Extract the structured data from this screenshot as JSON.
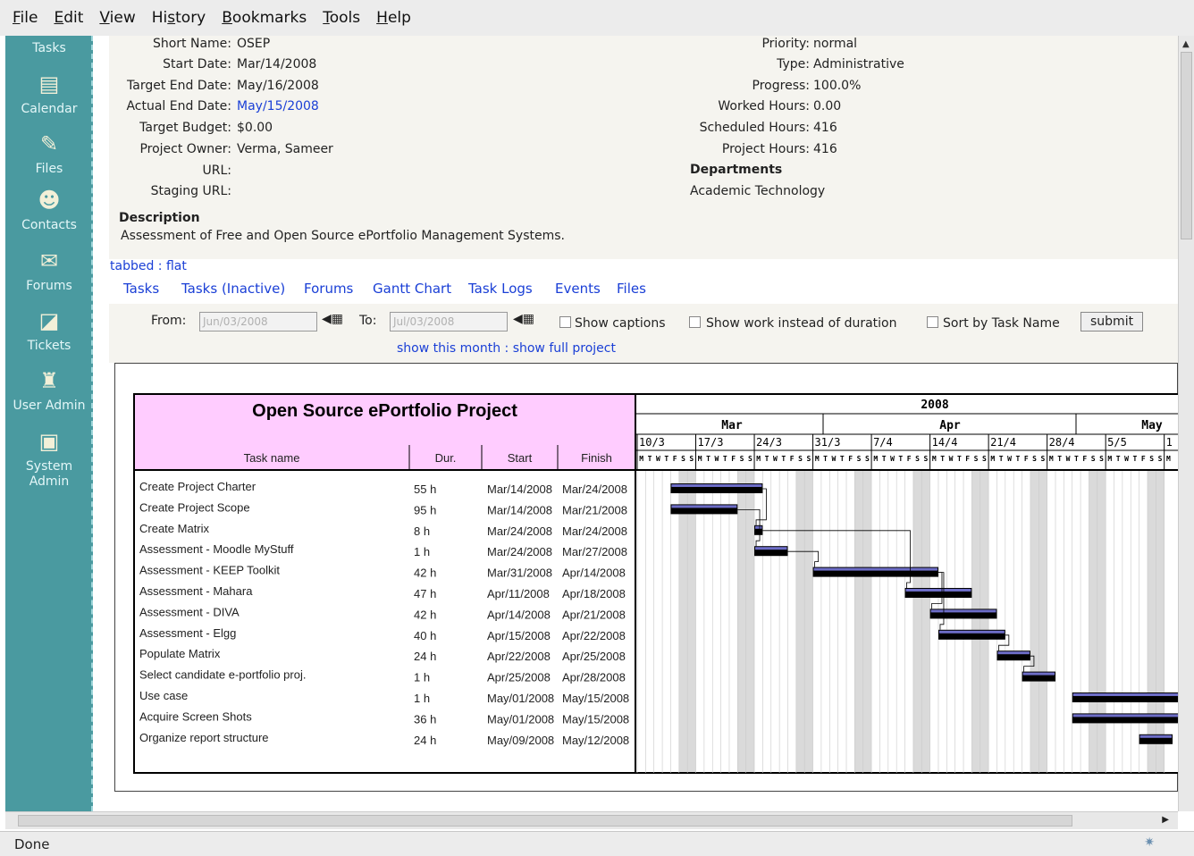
{
  "menu": [
    {
      "label": "File",
      "key": "F",
      "rest": "ile"
    },
    {
      "label": "Edit",
      "key": "E",
      "rest": "dit"
    },
    {
      "label": "View",
      "key": "V",
      "rest": "iew"
    },
    {
      "label": "History",
      "key": "H",
      "pre": "Hi",
      "u": "s",
      "post": "tory"
    },
    {
      "label": "Bookmarks",
      "key": "B",
      "rest": "ookmarks"
    },
    {
      "label": "Tools",
      "key": "T",
      "rest": "ools"
    },
    {
      "label": "Help",
      "key": "H",
      "rest": "elp"
    }
  ],
  "sidebar": {
    "items": [
      {
        "label": "Tasks",
        "icon": "tasks-icon"
      },
      {
        "label": "Calendar",
        "icon": "calendar-icon"
      },
      {
        "label": "Files",
        "icon": "files-icon"
      },
      {
        "label": "Contacts",
        "icon": "contacts-icon"
      },
      {
        "label": "Forums",
        "icon": "forums-icon"
      },
      {
        "label": "Tickets",
        "icon": "tickets-icon"
      },
      {
        "label": "User Admin",
        "icon": "user-admin-icon"
      },
      {
        "label": "System Admin",
        "icon": "system-admin-icon"
      }
    ]
  },
  "project": {
    "short_name_label": "Short Name:",
    "short_name": "OSEP",
    "start_date_label": "Start Date:",
    "start_date": "Mar/14/2008",
    "target_end_label": "Target End Date:",
    "target_end": "May/16/2008",
    "actual_end_label": "Actual End Date:",
    "actual_end": "May/15/2008",
    "budget_label": "Target Budget:",
    "budget": "$0.00",
    "owner_label": "Project Owner:",
    "owner": "Verma, Sameer",
    "url_label": "URL:",
    "staging_label": "Staging URL:",
    "priority_label": "Priority:",
    "priority": "normal",
    "type_label": "Type:",
    "type": "Administrative",
    "progress_label": "Progress:",
    "progress": "100.0%",
    "worked_label": "Worked Hours:",
    "worked": "0.00",
    "scheduled_label": "Scheduled Hours:",
    "scheduled": "416",
    "project_hours_label": "Project Hours:",
    "project_hours": "416",
    "departments_label": "Departments",
    "department": "Academic Technology",
    "description_label": "Description",
    "description": "Assessment of Free and Open Source ePortfolio Management Systems."
  },
  "view_modes": {
    "tabbed": "tabbed",
    "sep": ":",
    "flat": "flat"
  },
  "tabs": [
    "Tasks",
    "Tasks (Inactive)",
    "Forums",
    "Gantt Chart",
    "Task Logs",
    "Events",
    "Files"
  ],
  "filters": {
    "from_label": "From:",
    "from_value": "Jun/03/2008",
    "to_label": "To:",
    "to_value": "Jul/03/2008",
    "show_captions": "Show captions",
    "show_work": "Show work instead of duration",
    "sort_by_name": "Sort by Task Name",
    "submit": "submit",
    "show_month": "show this month",
    "sep": ":",
    "show_full": "show full project"
  },
  "chart_data": {
    "type": "gantt",
    "title": "Open Source ePortfolio Project",
    "columns": [
      "Task name",
      "Dur.",
      "Start",
      "Finish"
    ],
    "year": "2008",
    "months": [
      "Mar",
      "Apr",
      "May"
    ],
    "weeks": [
      "10/3",
      "17/3",
      "24/3",
      "31/3",
      "7/4",
      "14/4",
      "21/4",
      "28/4",
      "5/5",
      "1"
    ],
    "day_letters": "MTWTFSS",
    "timeline_start": "2008-03-10",
    "tasks": [
      {
        "name": "Create Project Charter",
        "dur": "55 h",
        "start": "Mar/14/2008",
        "finish": "Mar/24/2008",
        "s": "2008-03-14",
        "f": "2008-03-24"
      },
      {
        "name": "Create Project Scope",
        "dur": "95 h",
        "start": "Mar/14/2008",
        "finish": "Mar/21/2008",
        "s": "2008-03-14",
        "f": "2008-03-21"
      },
      {
        "name": "Create Matrix",
        "dur": "8 h",
        "start": "Mar/24/2008",
        "finish": "Mar/24/2008",
        "s": "2008-03-24",
        "f": "2008-03-24"
      },
      {
        "name": "Assessment - Moodle MyStuff",
        "dur": "1 h",
        "start": "Mar/24/2008",
        "finish": "Mar/27/2008",
        "s": "2008-03-24",
        "f": "2008-03-27"
      },
      {
        "name": "Assessment - KEEP Toolkit",
        "dur": "42 h",
        "start": "Mar/31/2008",
        "finish": "Apr/14/2008",
        "s": "2008-03-31",
        "f": "2008-04-14"
      },
      {
        "name": "Assessment - Mahara",
        "dur": "47 h",
        "start": "Apr/11/2008",
        "finish": "Apr/18/2008",
        "s": "2008-04-11",
        "f": "2008-04-18"
      },
      {
        "name": "Assessment - DIVA",
        "dur": "42 h",
        "start": "Apr/14/2008",
        "finish": "Apr/21/2008",
        "s": "2008-04-14",
        "f": "2008-04-21"
      },
      {
        "name": "Assessment - Elgg",
        "dur": "40 h",
        "start": "Apr/15/2008",
        "finish": "Apr/22/2008",
        "s": "2008-04-15",
        "f": "2008-04-22"
      },
      {
        "name": "Populate Matrix",
        "dur": "24 h",
        "start": "Apr/22/2008",
        "finish": "Apr/25/2008",
        "s": "2008-04-22",
        "f": "2008-04-25"
      },
      {
        "name": "Select candidate e-portfolio proj.",
        "dur": "1 h",
        "start": "Apr/25/2008",
        "finish": "Apr/28/2008",
        "s": "2008-04-25",
        "f": "2008-04-28"
      },
      {
        "name": "Use case",
        "dur": "1 h",
        "start": "May/01/2008",
        "finish": "May/15/2008",
        "s": "2008-05-01",
        "f": "2008-05-15"
      },
      {
        "name": "Acquire Screen Shots",
        "dur": "36 h",
        "start": "May/01/2008",
        "finish": "May/15/2008",
        "s": "2008-05-01",
        "f": "2008-05-15"
      },
      {
        "name": "Organize report structure",
        "dur": "24 h",
        "start": "May/09/2008",
        "finish": "May/12/2008",
        "s": "2008-05-09",
        "f": "2008-05-12"
      }
    ]
  },
  "status": {
    "text": "Done"
  }
}
